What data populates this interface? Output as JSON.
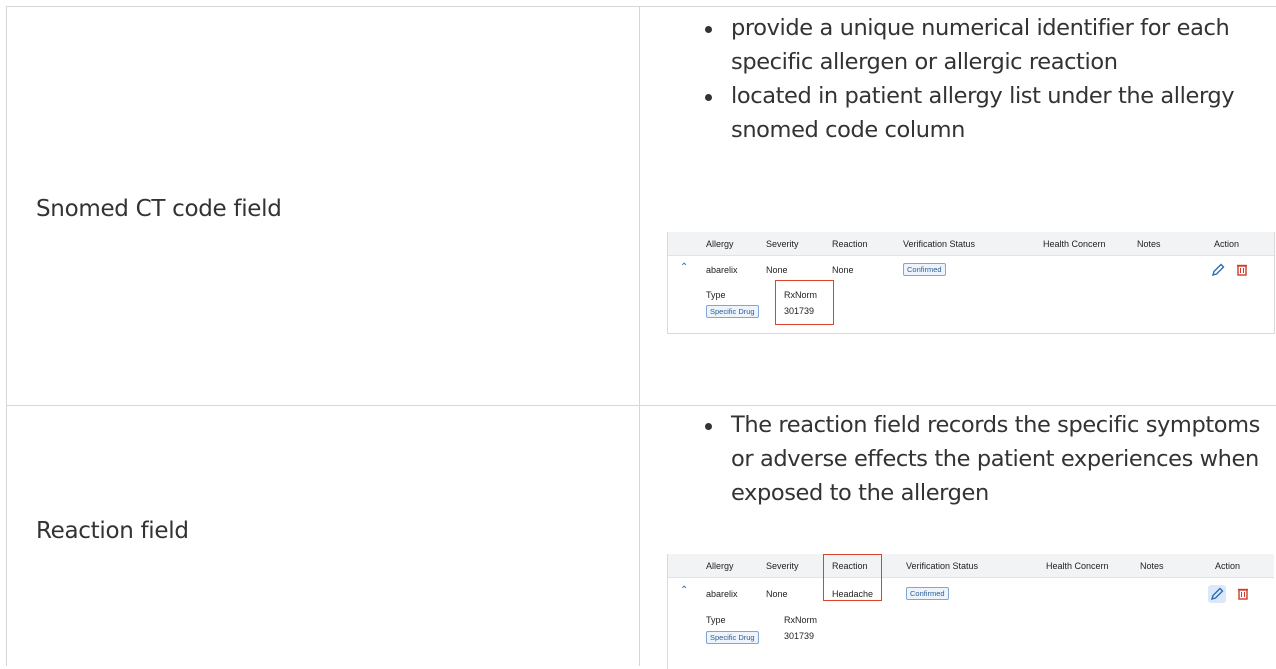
{
  "rows": [
    {
      "label": "Snomed CT code field",
      "bullets": [
        "provide a unique numerical identifier for each specific allergen or allergic reaction",
        "located in patient allergy list under the allergy snomed code column"
      ],
      "screenshot": {
        "headers": [
          "Allergy",
          "Severity",
          "Reaction",
          "Verification Status",
          "Health Concern",
          "Notes",
          "Action"
        ],
        "row": {
          "allergy": "abarelix",
          "severity": "None",
          "reaction": "None",
          "verification": "Confirmed"
        },
        "detail": {
          "type_label": "Type",
          "type_value": "Specific Drug",
          "code_label": "RxNorm",
          "code_value": "301739"
        },
        "highlight": "rxnorm"
      }
    },
    {
      "label": "Reaction field",
      "bullets": [
        "The reaction field records the specific symptoms or adverse effects the patient experiences when exposed to the allergen"
      ],
      "screenshot": {
        "headers": [
          "Allergy",
          "Severity",
          "Reaction",
          "Verification Status",
          "Health Concern",
          "Notes",
          "Action"
        ],
        "row": {
          "allergy": "abarelix",
          "severity": "None",
          "reaction": "Headache",
          "verification": "Confirmed"
        },
        "detail": {
          "type_label": "Type",
          "type_value": "Specific Drug",
          "code_label": "RxNorm",
          "code_value": "301739"
        },
        "highlight": "reaction"
      }
    }
  ],
  "icons": {
    "expand": "chevron-up-icon",
    "edit": "pencil-icon",
    "delete": "trash-icon"
  },
  "colors": {
    "highlight_box": "#d9452b",
    "edit_icon": "#2c6cb0",
    "delete_icon": "#d33a2c",
    "badge_border": "#7ea6d6"
  }
}
